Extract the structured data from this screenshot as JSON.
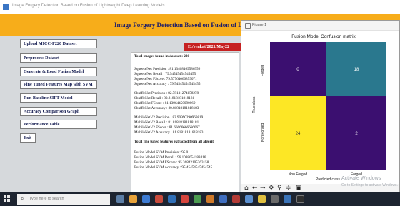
{
  "window": {
    "title": "Image Forgery Detection Based on Fusion of Lightweight Deep Learning Models"
  },
  "header": {
    "heading": "Image Forgery Detection Based on Fusion of Lig"
  },
  "buttons": [
    "Upload MICC-F220 Dataset",
    "Preprocess Dataset",
    "Generate & Load Fusion Model",
    "Fine Tuned Features Map with SVM",
    "Run Baseline SIFT Model",
    "Accuracy Comparison Graph",
    "Performance Table",
    "Exit"
  ],
  "file_label": "E:/venkat/2021/May22",
  "output_lines": [
    "Total images found in dataset : 220",
    "",
    "SqueezeNet Precision : 81.13468469586956",
    "SqueezeNet Recall : 79.54545454545455",
    "SqueezeNet FScore : 79.57764060859071",
    "SqueezeNet Accuracy : 79.54545454545455",
    "",
    "ShuffleNet Precision : 82.78131274158278",
    "ShuffleNet Recall : 80.81818181818181",
    "ShuffleNet FScore : 81.13964450090069",
    "ShuffleNet Accuracy : 80.81818181818183",
    "",
    "MobileNetV2 Precision : 82.90990290969819",
    "MobileNetV2 Recall : 81.81818181818181",
    "MobileNetV2 FScore : 81.66666666666667",
    "MobileNetV2 Accuracy : 81.81818181818183",
    "",
    "Total fine tuned features extracted from all algorit",
    "",
    "Fusion Model SVM Precision : 95.0",
    "Fusion Model SVM Recall : 96.1098654188416",
    "Fusion Model SVM FScore : 95.36842105263158",
    "Fusion Model SVM Accuracy : 95.45454545454545"
  ],
  "figure": {
    "window_title": "Figure 1",
    "plot_title": "Fusion Model Confusion matrix",
    "y_label": "True class",
    "x_label": "Predicted class",
    "row_labels": [
      "Forged",
      "Non Forged"
    ],
    "col_labels": [
      "Non Forged",
      "Forged"
    ],
    "cells": [
      {
        "value": "0",
        "color": "#3b0f70"
      },
      {
        "value": "18",
        "color": "#2a788e"
      },
      {
        "value": "24",
        "color": "#fde725"
      },
      {
        "value": "2",
        "color": "#3b0f70"
      }
    ],
    "toolbar_icons": [
      "home-icon",
      "back-icon",
      "forward-icon",
      "pan-icon",
      "zoom-icon",
      "configure-icon",
      "save-icon"
    ]
  },
  "taskbar": {
    "search_placeholder": "Type here to search"
  },
  "watermark": {
    "line1": "Activate Windows",
    "line2": "Go to Settings to activate Windows."
  },
  "colors": {
    "banner": "#f7ad1a",
    "file_label": "#c62121",
    "taskbar": "#1d2430"
  }
}
